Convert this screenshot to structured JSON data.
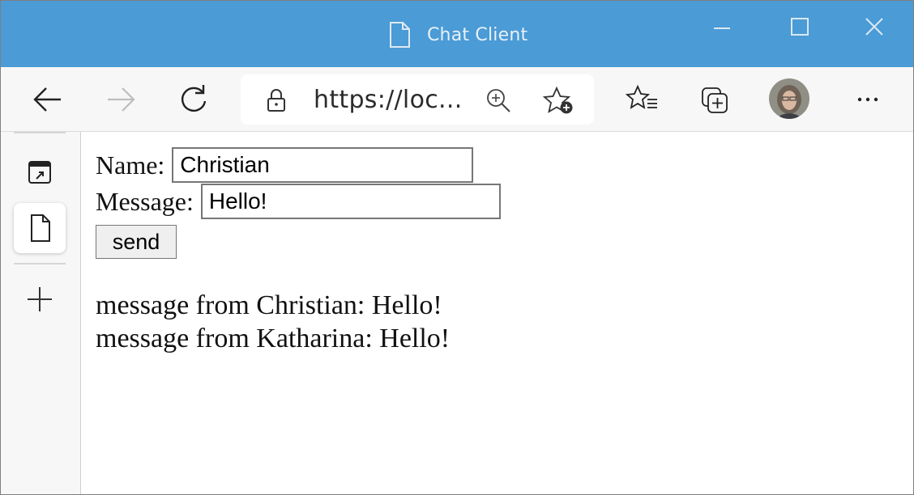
{
  "window": {
    "title": "Chat Client",
    "title_icon": "document-icon",
    "controls": [
      "minimize-icon",
      "maximize-icon",
      "close-icon"
    ]
  },
  "toolbar": {
    "buttons": [
      "back-arrow-icon",
      "forward-arrow-icon",
      "refresh-icon"
    ],
    "address": {
      "url_text": "https://loc...",
      "icons": [
        "lock-icon",
        "zoom-in-icon",
        "add-favorite-icon"
      ]
    },
    "right_buttons": [
      "favorites-icon",
      "collections-icon",
      "profile-avatar",
      "more-icon"
    ],
    "more_label": "···"
  },
  "sidebar": {
    "items": [
      "tab-actions-icon",
      "document-tab-icon",
      "new-tab-plus-icon"
    ]
  },
  "form": {
    "name_label": "Name:",
    "name_value": "Christian",
    "message_label": "Message:",
    "message_value": "Hello!",
    "send_label": "send"
  },
  "messages": [
    "message from Christian: Hello!",
    "message from Katharina: Hello!"
  ],
  "colors": {
    "titlebar": "#4a9bd6",
    "toolbar": "#f7f7f7",
    "content_bg": "#ffffff"
  }
}
